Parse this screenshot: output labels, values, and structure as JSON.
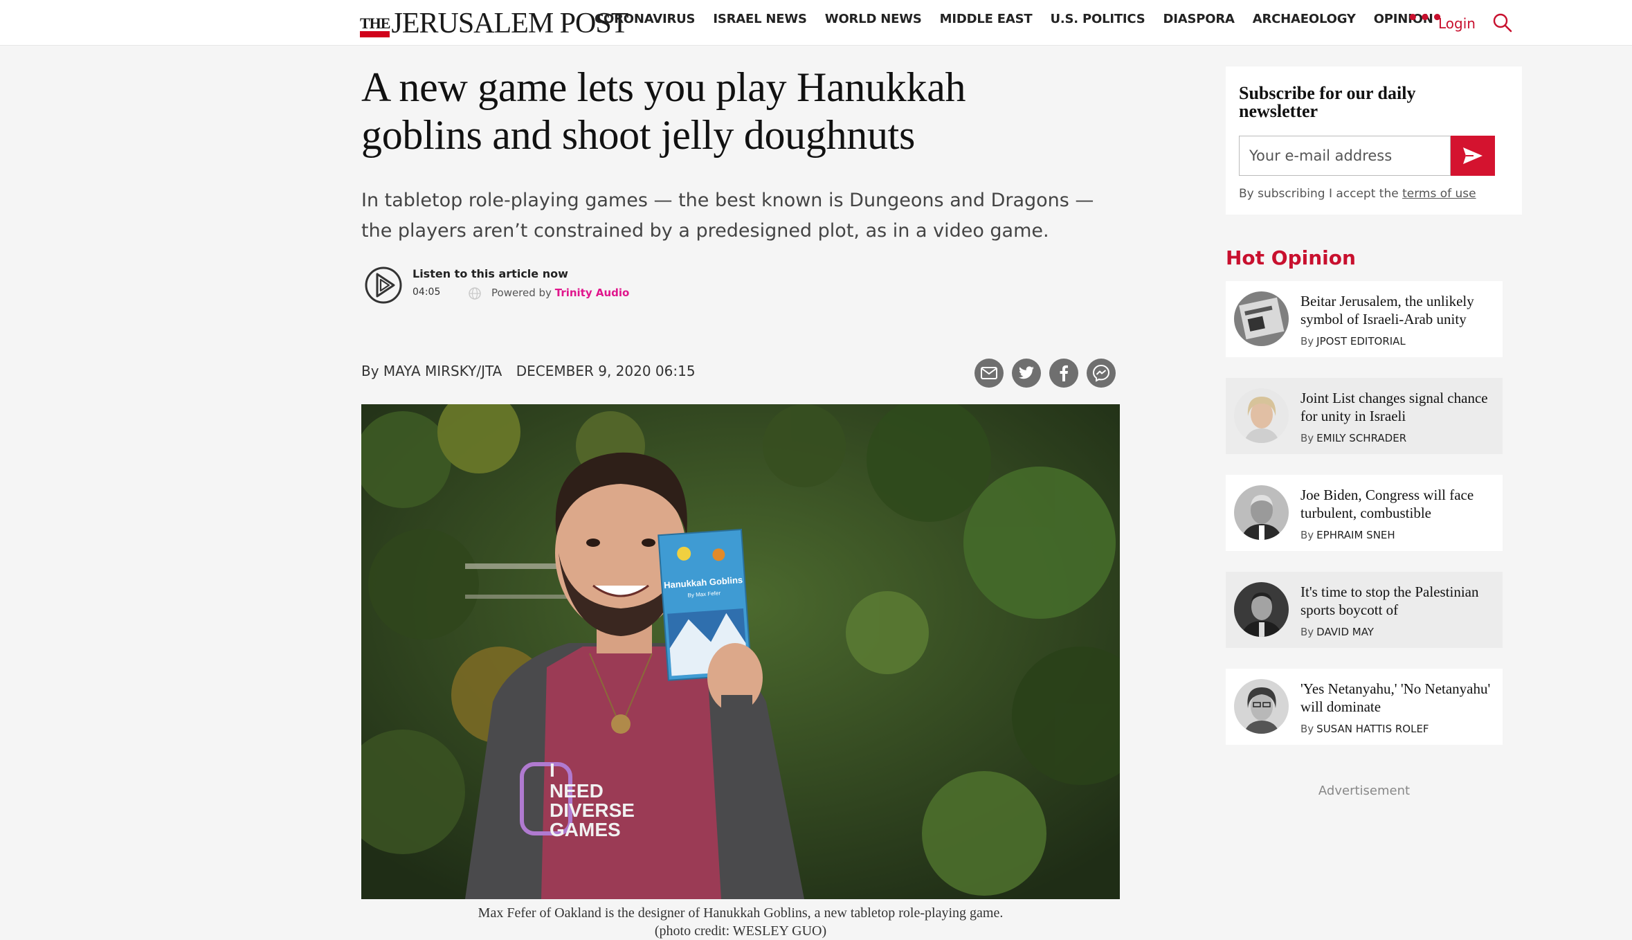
{
  "header": {
    "logo_the": "THE",
    "logo_name": "JERUSALEM POST",
    "nav": [
      "CORONAVIRUS",
      "ISRAEL NEWS",
      "WORLD NEWS",
      "MIDDLE EAST",
      "U.S. POLITICS",
      "DIASPORA",
      "ARCHAEOLOGY",
      "OPINION"
    ],
    "more": "•••",
    "login": "Login",
    "search_icon": "search-icon"
  },
  "article": {
    "headline": "A new game lets you play Hanukkah goblins and shoot jelly doughnuts",
    "lede": "In tabletop role-playing games — the best known is Dungeons and Dragons — the players aren’t constrained by a predesigned plot, as in a video game.",
    "audio": {
      "title": "Listen to this article now",
      "duration": "04:05",
      "powered_prefix": "Powered by",
      "powered_brand": "Trinity Audio"
    },
    "byline_prefix": "By",
    "author": "MAYA MIRSKY/JTA",
    "date": "DECEMBER 9, 2020 06:15",
    "share": [
      "email-icon",
      "twitter-icon",
      "facebook-icon",
      "messenger-icon"
    ],
    "photo": {
      "shirt_text": [
        "I",
        "NEED",
        "DIVERSE",
        "GAMES"
      ],
      "book_title": "Hanukkah Goblins",
      "book_author": "By Max Fefer"
    },
    "caption_line1": "Max Fefer of Oakland is the designer of Hanukkah Goblins, a new tabletop role-playing game.",
    "caption_line2": "(photo credit: WESLEY GUO)"
  },
  "sidebar": {
    "newsletter": {
      "title": "Subscribe for our daily newsletter",
      "email_placeholder": "Your e-mail address",
      "terms_prefix": "By subscribing I accept the",
      "terms_link": "terms of use"
    },
    "hot_opinion_title": "Hot Opinion",
    "by_label": "By",
    "opinions": [
      {
        "title": "Beitar Jerusalem, the unlikely symbol of Israeli-Arab unity",
        "author": "JPOST EDITORIAL"
      },
      {
        "title": "Joint List changes signal chance for unity in Israeli",
        "author": "EMILY SCHRADER"
      },
      {
        "title": "Joe Biden, Congress will face turbulent, combustible",
        "author": "EPHRAIM SNEH"
      },
      {
        "title": "It's time to stop the Palestinian sports boycott of",
        "author": "DAVID MAY"
      },
      {
        "title": "'Yes Netanyahu,' 'No Netanyahu' will dominate",
        "author": "SUSAN HATTIS ROLEF"
      }
    ],
    "advertisement": "Advertisement"
  },
  "colors": {
    "brand_red": "#c8102e",
    "send_button": "#d4132f",
    "trinity_pink": "#e0168c",
    "share_gray": "#6f6f6f"
  }
}
